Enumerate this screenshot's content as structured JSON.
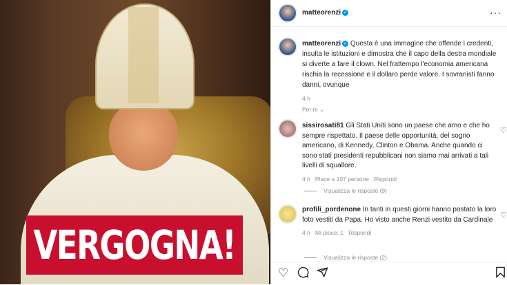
{
  "post": {
    "overlay_text": "VERGOGNA!"
  },
  "header": {
    "username": "matteorenzi",
    "more": "···"
  },
  "caption": {
    "username": "matteorenzi",
    "text": "Questa è una immagine che offende i credenti, insulta le istituzioni e dimostra che il capo della destra mondiale si diverte a fare il clown. Nel frattempo l'economia americana rischia la recessione e il dollaro perde valore. I sovranisti fanno danni, ovunque",
    "time": "4 h"
  },
  "translate": "Per te",
  "comments": [
    {
      "username": "sissirosati81",
      "text": "Gli Stati Uniti sono un paese che amo e che ho sempre rispettato. Il paese delle opportunità, del sogno americano, di Kennedy, Clinton e Obama. Anche quando ci sono stati presidenti repubblicani non siamo mai arrivati a tali livelli di squallore.",
      "time": "4 h",
      "likes": "Piace a 107 persone",
      "reply": "Rispondi",
      "view_replies": "Visualizza le risposte (9)"
    },
    {
      "username": "profili_pordenone",
      "text": "In tanti in questi giorni hanno postato la loro foto vestiti da Papa. Ho visto anche Renzi vestito da Cardinale",
      "time": "4 h",
      "likes": "Mi piace: 1",
      "reply": "Rispondi",
      "view_replies": "Visualizza le risposte (2)"
    }
  ],
  "icons": {
    "like": "heart-icon",
    "comment": "comment-icon",
    "share": "share-icon",
    "save": "bookmark-icon",
    "verified_color": "#0095f6",
    "banner_color": "#c8102e"
  }
}
